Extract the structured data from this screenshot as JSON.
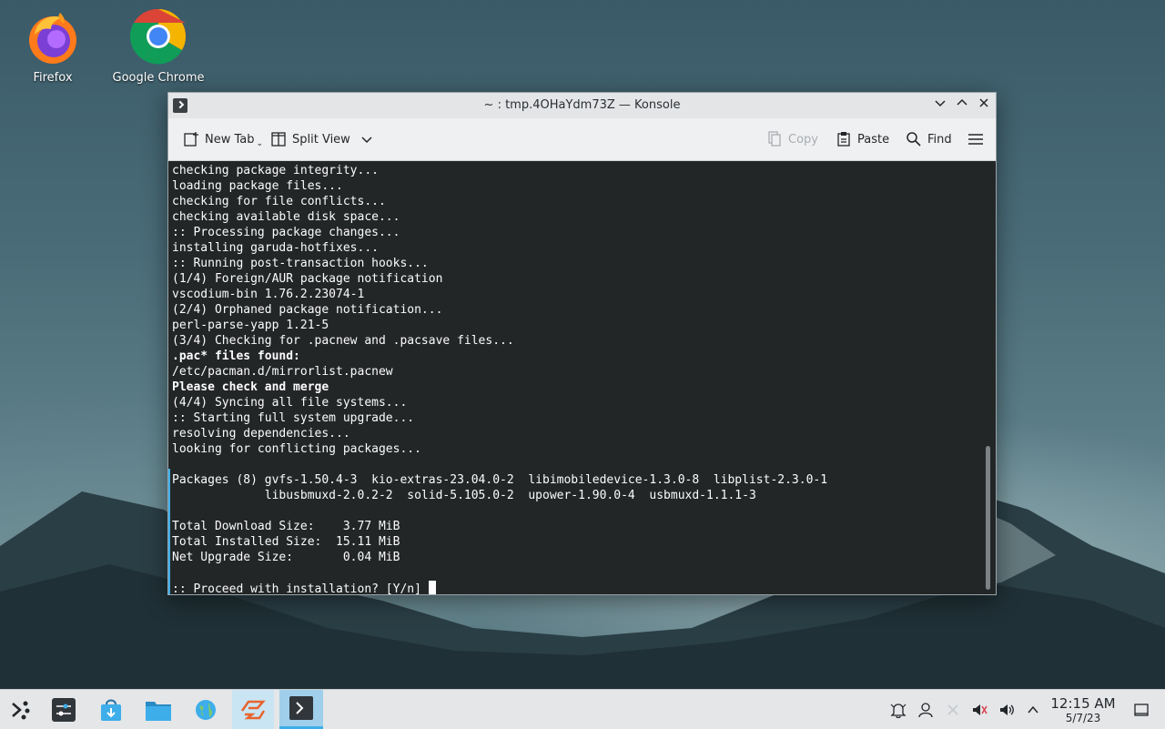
{
  "desktop": {
    "icons": [
      {
        "label": "Firefox",
        "icon": "firefox-icon"
      },
      {
        "label": "Google Chrome",
        "icon": "chrome-icon"
      }
    ]
  },
  "window": {
    "title": "~ : tmp.4OHaYdm73Z — Konsole",
    "toolbar": {
      "new_tab": "New Tab",
      "split_view": "Split View",
      "copy": "Copy",
      "paste": "Paste",
      "find": "Find"
    },
    "terminal": {
      "lines": [
        {
          "text": "checking package integrity...",
          "bold": false
        },
        {
          "text": "loading package files...",
          "bold": false
        },
        {
          "text": "checking for file conflicts...",
          "bold": false
        },
        {
          "text": "checking available disk space...",
          "bold": false
        },
        {
          "text": ":: Processing package changes...",
          "bold": false
        },
        {
          "text": "installing garuda-hotfixes...",
          "bold": false
        },
        {
          "text": ":: Running post-transaction hooks...",
          "bold": false
        },
        {
          "text": "(1/4) Foreign/AUR package notification",
          "bold": false
        },
        {
          "text": "vscodium-bin 1.76.2.23074-1",
          "bold": false
        },
        {
          "text": "(2/4) Orphaned package notification...",
          "bold": false
        },
        {
          "text": "perl-parse-yapp 1.21-5",
          "bold": false
        },
        {
          "text": "(3/4) Checking for .pacnew and .pacsave files...",
          "bold": false
        },
        {
          "text": ".pac* files found:",
          "bold": true
        },
        {
          "text": "/etc/pacman.d/mirrorlist.pacnew",
          "bold": false
        },
        {
          "text": "Please check and merge",
          "bold": true
        },
        {
          "text": "(4/4) Syncing all file systems...",
          "bold": false
        },
        {
          "text": ":: Starting full system upgrade...",
          "bold": false
        },
        {
          "text": "resolving dependencies...",
          "bold": false
        },
        {
          "text": "looking for conflicting packages...",
          "bold": false
        },
        {
          "text": "",
          "bold": false
        },
        {
          "text": "Packages (8) gvfs-1.50.4-3  kio-extras-23.04.0-2  libimobiledevice-1.3.0-8  libplist-2.3.0-1",
          "bold": false
        },
        {
          "text": "             libusbmuxd-2.0.2-2  solid-5.105.0-2  upower-1.90.0-4  usbmuxd-1.1.1-3",
          "bold": false
        },
        {
          "text": "",
          "bold": false
        },
        {
          "text": "Total Download Size:    3.77 MiB",
          "bold": false
        },
        {
          "text": "Total Installed Size:  15.11 MiB",
          "bold": false
        },
        {
          "text": "Net Upgrade Size:       0.04 MiB",
          "bold": false
        },
        {
          "text": "",
          "bold": false
        }
      ],
      "prompt": ":: Proceed with installation? [Y/n] "
    }
  },
  "taskbar": {
    "items": [
      {
        "icon": "application-launcher-icon"
      },
      {
        "icon": "system-settings-icon"
      },
      {
        "icon": "software-store-icon"
      },
      {
        "icon": "file-manager-icon"
      },
      {
        "icon": "web-browser-icon"
      },
      {
        "icon": "garuda-assistant-icon"
      },
      {
        "icon": "konsole-icon"
      }
    ],
    "tray": [
      {
        "icon": "notifications-icon"
      },
      {
        "icon": "user-icon"
      },
      {
        "icon": "network-disconnected-icon"
      },
      {
        "icon": "microphone-muted-icon"
      },
      {
        "icon": "volume-icon"
      },
      {
        "icon": "expand-tray-icon"
      }
    ],
    "clock": {
      "time": "12:15 AM",
      "date": "5/7/23"
    }
  }
}
